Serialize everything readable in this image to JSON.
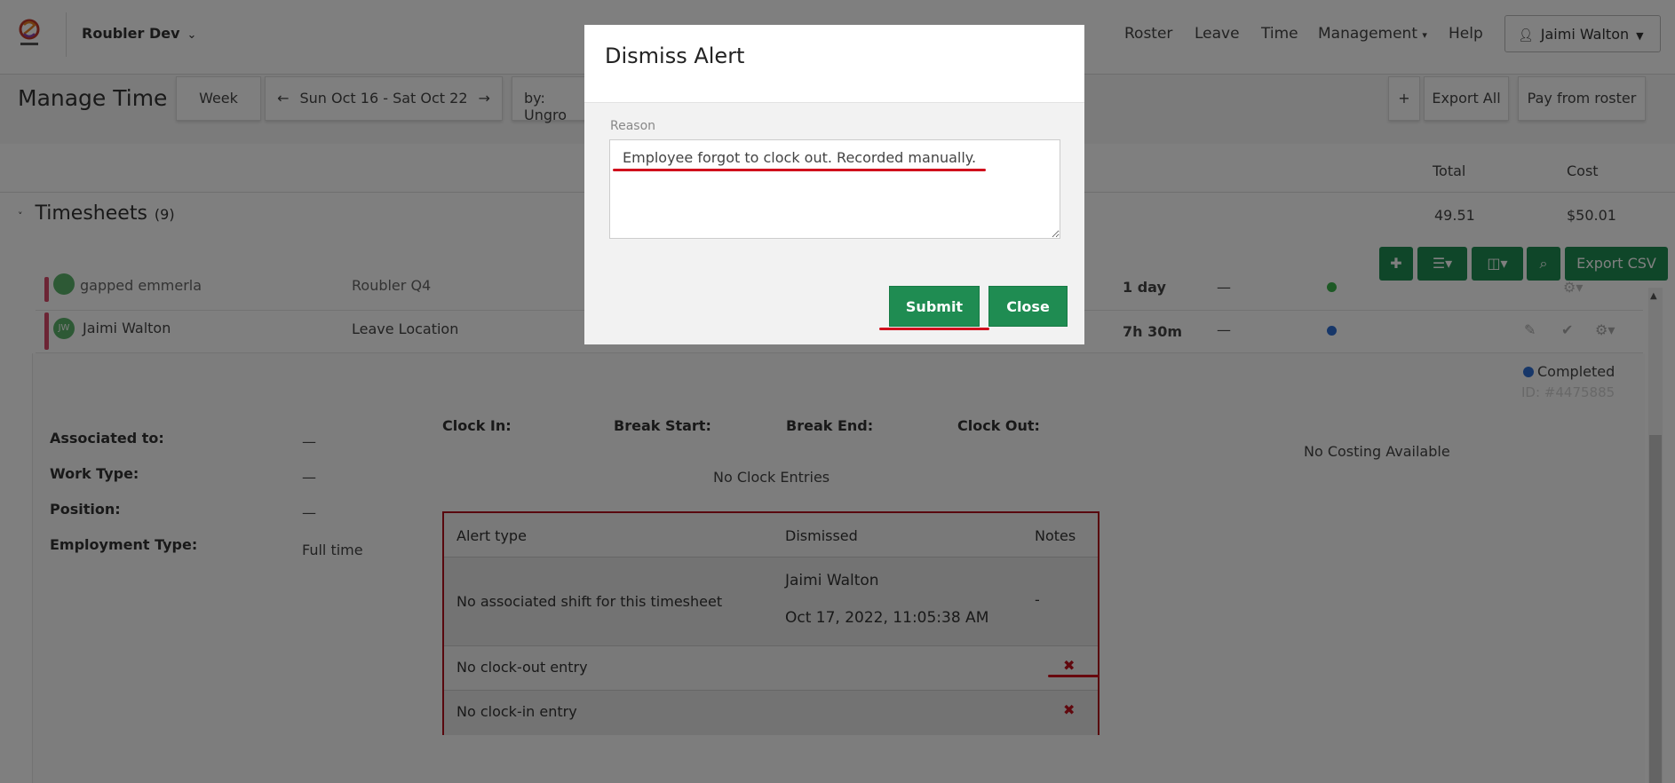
{
  "nav": {
    "org": "Roubler Dev",
    "items": [
      "Roster",
      "Leave",
      "Time",
      "Management",
      "Help"
    ],
    "user": "Jaimi Walton"
  },
  "toolbar": {
    "title": "Manage Time",
    "week": "Week",
    "range": "Sun Oct 16 - Sat Oct 22",
    "group_by": "by: Ungro",
    "plus": "+",
    "export_all": "Export All",
    "pay_from_roster": "Pay from roster"
  },
  "table": {
    "col_total": "Total",
    "col_cost": "Cost",
    "section": "Timesheets",
    "section_count": "(9)",
    "total_value": "49.51",
    "cost_value": "$50.01",
    "export_csv": "Export CSV"
  },
  "rows": [
    {
      "name": "gapped emmerla",
      "location": "Roubler Q4",
      "duration": "1 day",
      "dash": "—",
      "status_color": "#3bb34a"
    },
    {
      "name": "Jaimi Walton",
      "initials": "JW",
      "location": "Leave Location",
      "duration": "7h 30m",
      "dash": "—",
      "status_color": "#2f6fd3"
    }
  ],
  "detail": {
    "status": "Completed",
    "id": "ID: #4475885",
    "associated_label": "Associated to:",
    "associated_value": "—",
    "work_type_label": "Work Type:",
    "work_type_value": "—",
    "position_label": "Position:",
    "position_value": "—",
    "employment_label": "Employment Type:",
    "employment_value": "Full time",
    "clock_in": "Clock In:",
    "break_start": "Break Start:",
    "break_end": "Break End:",
    "clock_out": "Clock Out:",
    "no_clock": "No Clock Entries",
    "no_costing": "No Costing Available"
  },
  "alerts": {
    "headers": [
      "Alert type",
      "Dismissed",
      "Notes"
    ],
    "rows": [
      {
        "type": "No associated shift for this timesheet",
        "dismissed_by": "Jaimi Walton",
        "dismissed_at": "Oct 17, 2022, 11:05:38 AM",
        "notes": "-"
      },
      {
        "type": "No clock-out entry"
      },
      {
        "type": "No clock-in entry"
      }
    ]
  },
  "modal": {
    "title": "Dismiss Alert",
    "reason_label": "Reason",
    "reason_value": "Employee forgot to clock out. Recorded manually.",
    "submit": "Submit",
    "close": "Close"
  },
  "colors": {
    "green": "#1f8c52",
    "red": "#c0101d"
  }
}
